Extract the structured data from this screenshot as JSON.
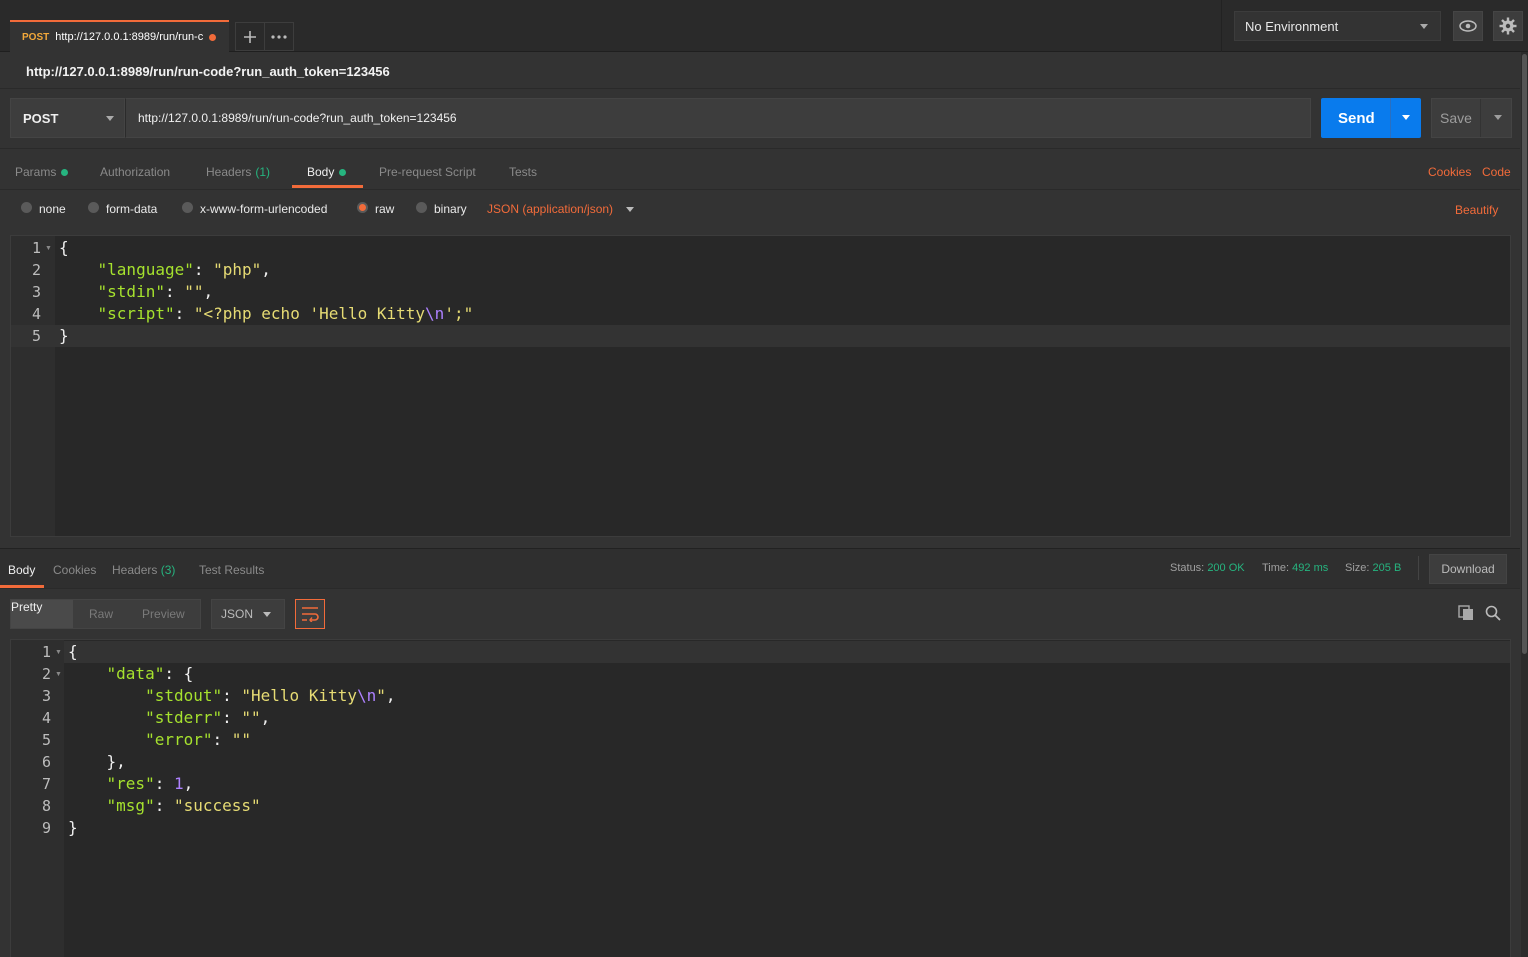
{
  "tab": {
    "method": "POST",
    "title": "http://127.0.0.1:8989/run/run-c"
  },
  "environment": {
    "selected": "No Environment"
  },
  "request": {
    "title": "http://127.0.0.1:8989/run/run-code?run_auth_token=123456",
    "method": "POST",
    "url": "http://127.0.0.1:8989/run/run-code?run_auth_token=123456",
    "send_label": "Send",
    "save_label": "Save"
  },
  "request_tabs": {
    "params": "Params",
    "authorization": "Authorization",
    "headers": "Headers",
    "headers_count": "(1)",
    "body": "Body",
    "prerequest": "Pre-request Script",
    "tests": "Tests",
    "cookies": "Cookies",
    "code": "Code"
  },
  "body_types": {
    "none": "none",
    "form_data": "form-data",
    "urlencoded": "x-www-form-urlencoded",
    "raw": "raw",
    "binary": "binary",
    "content_type": "JSON (application/json)",
    "beautify": "Beautify"
  },
  "request_body": {
    "line_numbers": [
      "1",
      "2",
      "3",
      "4",
      "5"
    ],
    "lines": [
      "{",
      "    \"language\": \"php\",",
      "    \"stdin\": \"\",",
      "    \"script\": \"<?php echo 'Hello Kitty\\n';\"",
      "}"
    ]
  },
  "response_tabs": {
    "body": "Body",
    "cookies": "Cookies",
    "headers": "Headers",
    "headers_count": "(3)",
    "test_results": "Test Results"
  },
  "response_status": {
    "status_label": "Status:",
    "status": "200 OK",
    "time_label": "Time:",
    "time": "492 ms",
    "size_label": "Size:",
    "size": "205 B",
    "download": "Download"
  },
  "response_view": {
    "pretty": "Pretty",
    "raw": "Raw",
    "preview": "Preview",
    "format": "JSON"
  },
  "response_body": {
    "line_numbers": [
      "1",
      "2",
      "3",
      "4",
      "5",
      "6",
      "7",
      "8",
      "9"
    ],
    "lines": [
      "{",
      "    \"data\": {",
      "        \"stdout\": \"Hello Kitty\\n\",",
      "        \"stderr\": \"\",",
      "        \"error\": \"\"",
      "    },",
      "    \"res\": 1,",
      "    \"msg\": \"success\"",
      "}"
    ]
  },
  "colors": {
    "accent": "#f26b3a",
    "send": "#097bed",
    "success": "#26b47f"
  }
}
